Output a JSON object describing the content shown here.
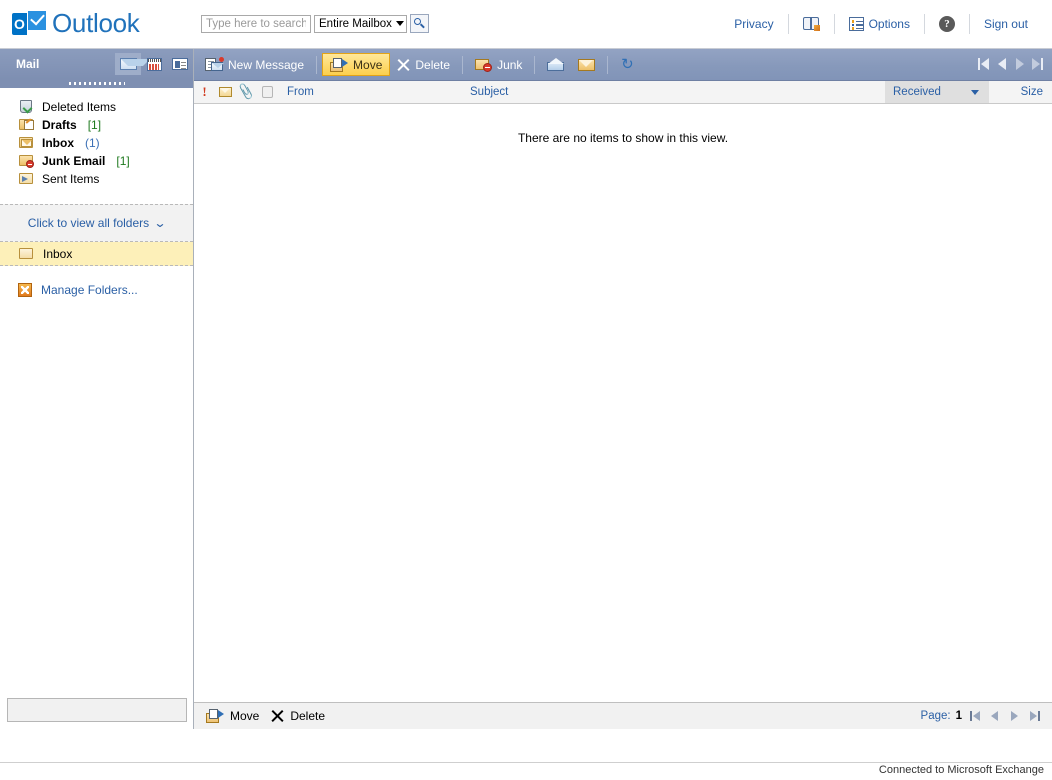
{
  "header": {
    "brand": {
      "logo_letter": "O",
      "product_name": "Outlook"
    },
    "search": {
      "placeholder": "Type here to search",
      "value": "",
      "scope_selected": "Entire Mailbox",
      "go_icon": "search-icon"
    },
    "links": [
      {
        "label": "Privacy",
        "icon": null
      },
      {
        "label": "",
        "icon": "address-book-icon"
      },
      {
        "label": "Options",
        "icon": "options-list-icon"
      },
      {
        "label": "",
        "icon": "help-question-icon"
      },
      {
        "label": "Sign out",
        "icon": null
      }
    ]
  },
  "sidebar": {
    "title": "Mail",
    "module_icons": [
      {
        "name": "mail-module-icon",
        "active": true
      },
      {
        "name": "calendar-module-icon",
        "active": false
      },
      {
        "name": "contacts-module-icon",
        "active": false
      }
    ],
    "folders": [
      {
        "label": "Deleted Items",
        "count": "",
        "count_style": "",
        "bold": false,
        "icon": "trash-folder-icon"
      },
      {
        "label": "Drafts",
        "count": "[1]",
        "count_style": "green",
        "bold": true,
        "icon": "drafts-folder-icon"
      },
      {
        "label": "Inbox",
        "count": "(1)",
        "count_style": "blue",
        "bold": true,
        "icon": "inbox-folder-icon"
      },
      {
        "label": "Junk Email",
        "count": "[1]",
        "count_style": "green",
        "bold": true,
        "icon": "junk-folder-icon"
      },
      {
        "label": "Sent Items",
        "count": "",
        "count_style": "",
        "bold": false,
        "icon": "sent-folder-icon"
      }
    ],
    "view_all_folders": "Click to view all folders",
    "view_all_chevron": "»",
    "selected_folder": "Inbox",
    "manage_folders": "Manage Folders..."
  },
  "toolbar": {
    "new_message": "New Message",
    "move": "Move",
    "delete": "Delete",
    "junk": "Junk",
    "mark_read_icon": "open-envelope-icon",
    "mark_unread_icon": "closed-envelope-icon",
    "refresh_icon": "refresh-icon",
    "nav": {
      "first": "first-page-icon",
      "previous": "previous-page-icon",
      "next": "next-page-icon",
      "last": "last-page-icon"
    }
  },
  "message_list": {
    "columns": {
      "importance_icon": "importance-icon",
      "read_icon": "read-status-icon",
      "attachment_icon": "attachment-icon",
      "flag_icon": "flag-icon",
      "from": "From",
      "subject": "Subject",
      "received": "Received",
      "size": "Size"
    },
    "sorted_by": "Received",
    "rows": [],
    "empty_text": "There are no items to show in this view."
  },
  "bottom_bar": {
    "move": "Move",
    "delete": "Delete",
    "page_label": "Page:",
    "page_number": "1"
  },
  "status": {
    "connection": "Connected to Microsoft Exchange"
  },
  "colors": {
    "brand_blue": "#0072c6",
    "link_blue": "#2a5fa5",
    "toolbar_slate": "#8799bb",
    "sidebar_header_slate": "#7e8fb2",
    "highlight_yellow": "#fdf0b9",
    "selected_button_gold": "#fccf4d",
    "count_green": "#1f7a1f"
  }
}
